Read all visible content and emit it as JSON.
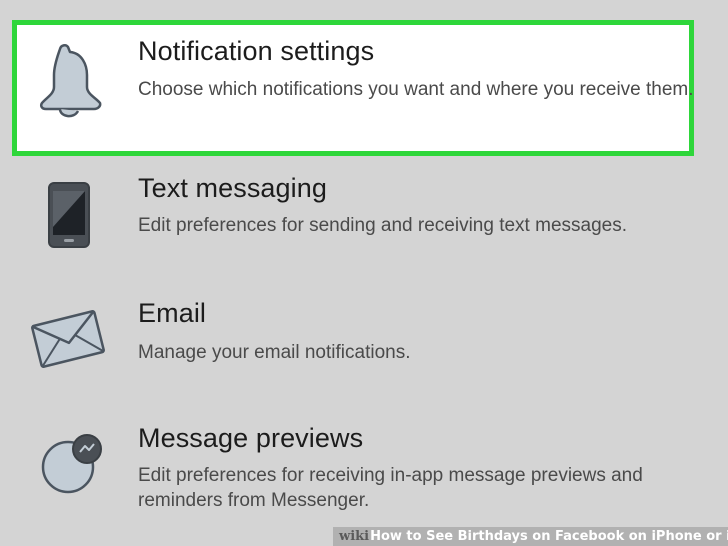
{
  "settings": {
    "items": [
      {
        "icon": "bell-icon",
        "title": "Notification settings",
        "description": "Choose which notifications you want and where you receive them.",
        "highlighted": true
      },
      {
        "icon": "phone-icon",
        "title": "Text messaging",
        "description": "Edit preferences for sending and receiving text messages.",
        "highlighted": false
      },
      {
        "icon": "envelope-icon",
        "title": "Email",
        "description": "Manage your email notifications.",
        "highlighted": false
      },
      {
        "icon": "messenger-icon",
        "title": "Message previews",
        "description": "Edit preferences for receiving in-app message previews and reminders from Messenger.",
        "highlighted": false
      }
    ]
  },
  "colors": {
    "highlight_border": "#2ed63a",
    "background": "#d4d4d4",
    "icon_fill": "#c3cdd6",
    "icon_stroke": "#4b5560"
  },
  "watermark": {
    "brand": "wiki",
    "text": "How to See Birthdays on Facebook on iPhone or iPad"
  }
}
